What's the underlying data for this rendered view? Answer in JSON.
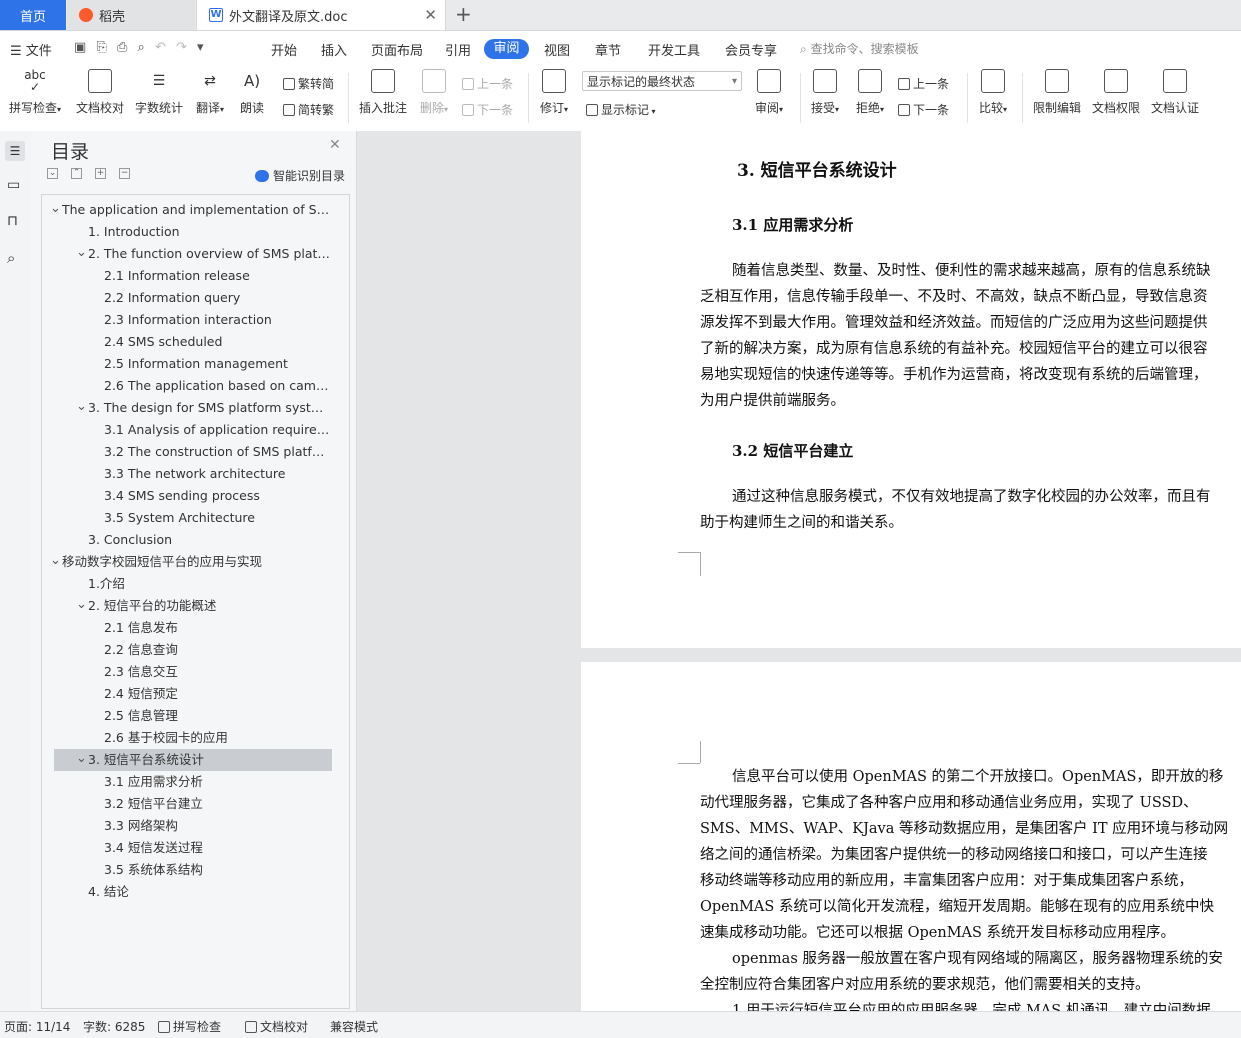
{
  "tabs": {
    "home": "首页",
    "daoke": "稻壳",
    "document": "外文翻译及原文.doc"
  },
  "menu": {
    "file": "文件",
    "items": [
      "开始",
      "插入",
      "页面布局",
      "引用",
      "审阅",
      "视图",
      "章节",
      "开发工具",
      "会员专享"
    ],
    "active": "审阅",
    "search_placeholder": "查找命令、搜索模板"
  },
  "ribbon": {
    "spell_check": "拼写检查",
    "doc_proofread": "文档校对",
    "word_count": "字数统计",
    "translate": "翻译",
    "read_aloud": "朗读",
    "trad_to_simp": "繁转简",
    "simp_to_trad": "简转繁",
    "insert_comment": "插入批注",
    "delete": "删除",
    "prev_comment": "上一条",
    "next_comment": "下一条",
    "revise": "修订",
    "markup_state": "显示标记的最终状态",
    "show_markup": "显示标记",
    "review": "审阅",
    "accept": "接受",
    "reject": "拒绝",
    "prev_change": "上一条",
    "next_change": "下一条",
    "compare": "比较",
    "restrict_edit": "限制编辑",
    "doc_permission": "文档权限",
    "doc_cert": "文档认证"
  },
  "toc": {
    "title": "目录",
    "smart_toc": "智能识别目录",
    "items": [
      {
        "text": "The application and implementation of SMS ...",
        "level": 0,
        "arrow": "v"
      },
      {
        "text": "1. Introduction",
        "level": 1,
        "arrow": ""
      },
      {
        "text": "2. The function overview of SMS platfor...",
        "level": 1,
        "arrow": "v"
      },
      {
        "text": "2.1 Information release",
        "level": 2,
        "arrow": ""
      },
      {
        "text": "2.2 Information query",
        "level": 2,
        "arrow": ""
      },
      {
        "text": "2.3 Information interaction",
        "level": 2,
        "arrow": ""
      },
      {
        "text": "2.4 SMS scheduled",
        "level": 2,
        "arrow": ""
      },
      {
        "text": "2.5 Information management",
        "level": 2,
        "arrow": ""
      },
      {
        "text": "2.6 The application based on campus ...",
        "level": 2,
        "arrow": ""
      },
      {
        "text": "3. The design for SMS platform system",
        "level": 1,
        "arrow": "v"
      },
      {
        "text": "3.1 Analysis of application requiremen...",
        "level": 2,
        "arrow": ""
      },
      {
        "text": "3.2 The construction of SMS platform",
        "level": 2,
        "arrow": ""
      },
      {
        "text": "3.3 The network architecture",
        "level": 2,
        "arrow": ""
      },
      {
        "text": "3.4 SMS sending process",
        "level": 2,
        "arrow": ""
      },
      {
        "text": "3.5 System Architecture",
        "level": 2,
        "arrow": ""
      },
      {
        "text": "3. Conclusion",
        "level": 1,
        "arrow": ""
      },
      {
        "text": "移动数字校园短信平台的应用与实现",
        "level": 0,
        "arrow": "v"
      },
      {
        "text": "1.介绍",
        "level": 1,
        "arrow": ""
      },
      {
        "text": "2.  短信平台的功能概述",
        "level": 1,
        "arrow": "v"
      },
      {
        "text": "2.1  信息发布",
        "level": 2,
        "arrow": ""
      },
      {
        "text": "2.2  信息查询",
        "level": 2,
        "arrow": ""
      },
      {
        "text": "2.3  信息交互",
        "level": 2,
        "arrow": ""
      },
      {
        "text": "2.4  短信预定",
        "level": 2,
        "arrow": ""
      },
      {
        "text": "2.5  信息管理",
        "level": 2,
        "arrow": ""
      },
      {
        "text": "2.6  基于校园卡的应用",
        "level": 2,
        "arrow": ""
      },
      {
        "text": "3.  短信平台系统设计",
        "level": 1,
        "arrow": "v",
        "selected": true
      },
      {
        "text": "3.1  应用需求分析",
        "level": 2,
        "arrow": ""
      },
      {
        "text": "3.2  短信平台建立",
        "level": 2,
        "arrow": ""
      },
      {
        "text": "3.3  网络架构",
        "level": 2,
        "arrow": ""
      },
      {
        "text": "3.4  短信发送过程",
        "level": 2,
        "arrow": ""
      },
      {
        "text": "3.5  系统体系结构",
        "level": 2,
        "arrow": ""
      },
      {
        "text": "4.  结论",
        "level": 1,
        "arrow": ""
      }
    ]
  },
  "document": {
    "page1": {
      "heading": "3.  短信平台系统设计",
      "sub1": "3.1  应用需求分析",
      "para1": [
        "随着信息类型、数量、及时性、便利性的需求越来越高，原有的信息系统缺",
        "乏相互作用，信息传输手段单一、不及时、不高效，缺点不断凸显，导致信息资",
        "源发挥不到最大作用。管理效益和经济效益。而短信的广泛应用为这些问题提供",
        "了新的解决方案，成为原有信息系统的有益补充。校园短信平台的建立可以很容",
        "易地实现短信的快速传递等等。手机作为运营商，将改变现有系统的后端管理，",
        "为用户提供前端服务。"
      ],
      "sub2": "3.2  短信平台建立",
      "para2": [
        "通过这种信息服务模式，不仅有效地提高了数字化校园的办公效率，而且有",
        "助于构建师生之间的和谐关系。"
      ]
    },
    "page2": {
      "lines": [
        "信息平台可以使用 OpenMAS 的第二个开放接口。OpenMAS，即开放的移",
        "动代理服务器，它集成了各种客户应用和移动通信业务应用，实现了 USSD、",
        "SMS、MMS、WAP、KJava 等移动数据应用，是集团客户 IT 应用环境与移动网",
        "络之间的通信桥梁。为集团客户提供统一的移动网络接口和接口，可以产生连接",
        "移动终端等移动应用的新应用，丰富集团客户应用：对于集成集团客户系统，",
        "OpenMAS 系统可以简化开发流程，缩短开发周期。能够在现有的应用系统中快",
        "速集成移动功能。它还可以根据 OpenMAS 系统开发目标移动应用程序。",
        "openmas 服务器一般放置在客户现有网络域的隔离区，服务器物理系统的安",
        "全控制应符合集团客户对应用系统的要求规范，他们需要相关的支持。",
        "1.用于运行短信平台应用的应用服务器，完成 MAS 机通讯，建立中间数据"
      ]
    }
  },
  "status": {
    "page": "页面: 11/14",
    "words": "字数: 6285",
    "spell": "拼写检查",
    "proof": "文档校对",
    "compat": "兼容模式"
  },
  "colors": {
    "accent": "#2f73e8",
    "selected_toc": "#c9ccd1"
  }
}
